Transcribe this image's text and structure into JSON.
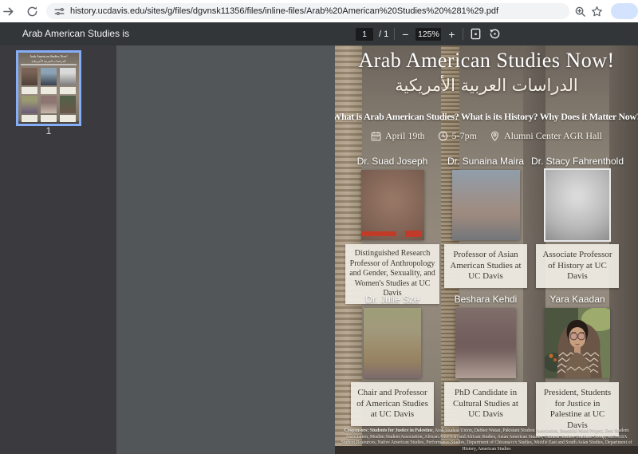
{
  "browser": {
    "url": "history.ucdavis.edu/sites/g/files/dgvnsk11356/files/inline-files/Arab%20American%20Studies%20%281%29.pdf"
  },
  "pdf_toolbar": {
    "document_title": "Arab American Studies is",
    "page_current": "1",
    "page_total_label": "/ 1",
    "zoom_out_label": "−",
    "zoom_level": "125%",
    "zoom_in_label": "+"
  },
  "sidebar": {
    "thumbnail_label": "1"
  },
  "flyer": {
    "title": "Arab American Studies Now!",
    "arabic_title": "الدراسات العربية الأمريكية",
    "question": "What is Arab American Studies? What is its History? Why Does it Matter Now?",
    "event": {
      "date": "April 19th",
      "time": "5-7pm",
      "location": "Alumni Center AGR Hall"
    },
    "speakers": [
      {
        "name": "Dr. Suad Joseph",
        "role": "Distinguished Research Professor of Anthropology and Gender, Sexuality, and Women's Studies at UC Davis"
      },
      {
        "name": "Dr. Sunaina Maira",
        "role": "Professor of Asian American Studies at UC Davis"
      },
      {
        "name": "Dr. Stacy Fahrenthold",
        "role": "Associate Professor of History at UC Davis"
      },
      {
        "name": "Dr. Julie Sze",
        "role": "Chair and Professor of American Studies at UC Davis"
      },
      {
        "name": "Beshara Kehdi",
        "role": "PhD Candidate in Cultural Studies at UC Davis"
      },
      {
        "name": "Yara Kaadan",
        "role": "President, Students for Justice in Palestine at UC Davis"
      }
    ],
    "cosponsors_lead": "Cosponsors: Students for Justice in Palestine",
    "cosponsors_rest": ", Arab Student Union, Dabket Watan, Pakistani Student Association, Beautiful Mind Project, Desi Student Association, Muslim Student Association, African American and African Studies, Asian American Studies, Cultural Studies Graduate Group, MENASA Student Resources, Native American Studies, Performance Studies, Department of Chicana/o/x Studies, Middle East and South Asian Studies, Department of History, American Studies"
  },
  "colors": {
    "toolbar_bg": "#333639",
    "viewer_bg": "#535659",
    "sidebar_bg": "#3a3a3f",
    "thumbnail_selection": "#84aef7",
    "card_bg": "#eeebe2",
    "accent_red": "#c23b28"
  }
}
